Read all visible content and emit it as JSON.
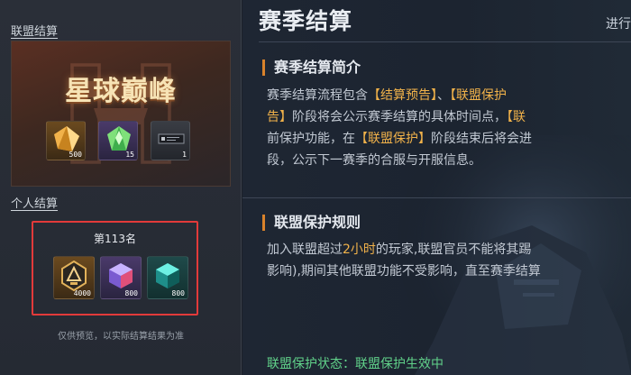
{
  "left": {
    "alliance_link": "联盟结算",
    "alliance_title": "星球巅峰",
    "alliance_rewards": [
      {
        "icon": "gold-crystal-icon",
        "qty": "500"
      },
      {
        "icon": "green-crystal-icon",
        "qty": "15"
      },
      {
        "icon": "badge-card-icon",
        "qty": "1"
      }
    ],
    "personal_link": "个人结算",
    "rank": "第113名",
    "personal_rewards": [
      {
        "icon": "rank-medal-icon",
        "qty": "4000"
      },
      {
        "icon": "purple-cube-icon",
        "qty": "800"
      },
      {
        "icon": "teal-cube-icon",
        "qty": "800"
      }
    ],
    "disclaimer": "仅供预览，以实际结算结果为准"
  },
  "right": {
    "title": "赛季结算",
    "status": "进行",
    "section1": {
      "heading": "赛季结算简介",
      "lines": [
        [
          "赛季结算流程包含",
          "【结算预告】",
          "、",
          "【联盟保护",
          ""
        ],
        [
          "告】",
          "阶段将会公示赛季结算的具体时间点，",
          "【联",
          "",
          ""
        ],
        [
          "前保护功能，在",
          "【联盟保护】",
          "阶段结束后将会进",
          "",
          ""
        ],
        [
          "段，公示下一赛季的合服与开服信息。",
          "",
          "",
          "",
          ""
        ]
      ]
    },
    "section2": {
      "heading": "联盟保护规则",
      "line1_a": "加入联盟超过",
      "line1_b": "2小时",
      "line1_c": "的玩家,联盟官员不能将其踢",
      "line2": "影响),期间其他联盟功能不受影响，直至赛季结算"
    },
    "protect_label": "联盟保护状态：",
    "protect_value": "联盟保护生效中"
  },
  "colors": {
    "highlight": "#f1b24a",
    "green": "#61d28a",
    "box_border": "#e23a3a"
  }
}
